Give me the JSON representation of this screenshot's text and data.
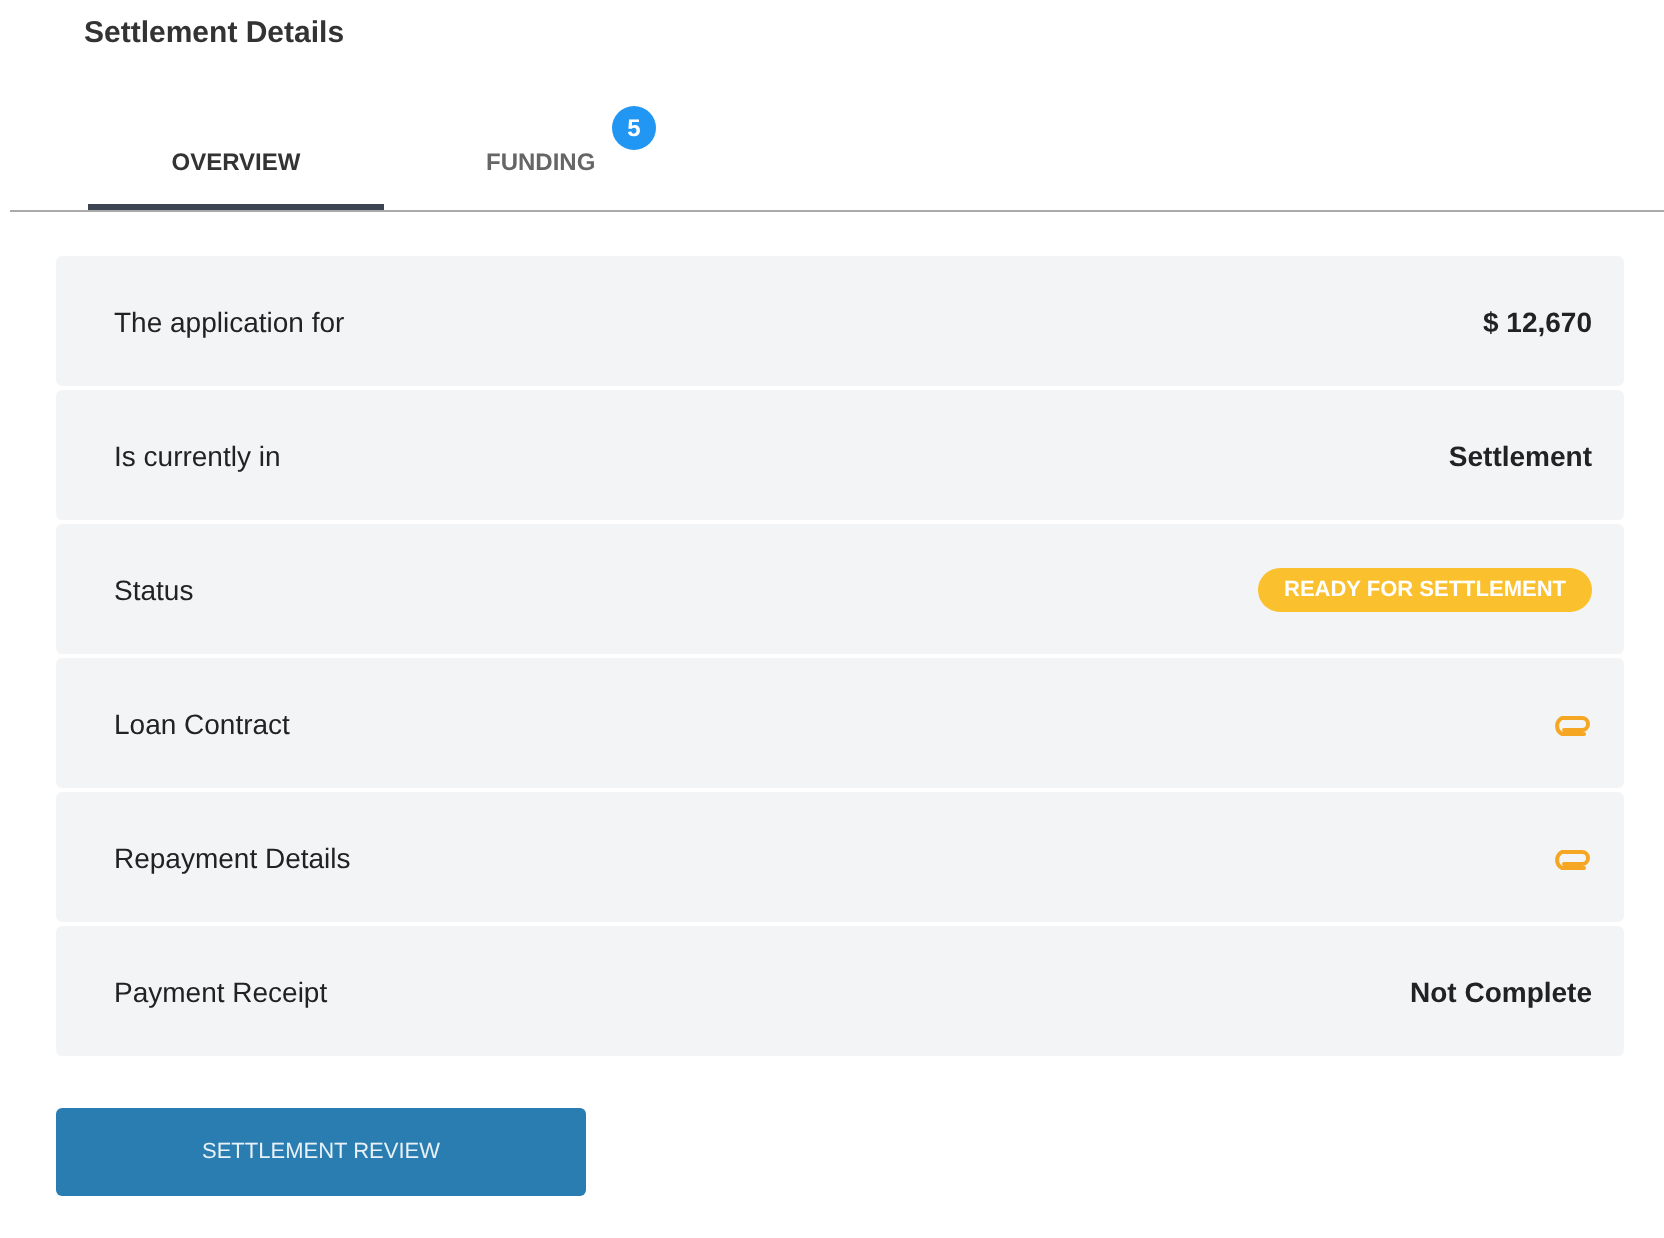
{
  "title": "Settlement Details",
  "tabs": [
    {
      "label": "OVERVIEW",
      "selected": true
    },
    {
      "label": "FUNDING",
      "selected": false,
      "badge": "5"
    }
  ],
  "rows": [
    {
      "label": "The application for",
      "kind": "text",
      "value": "$ 12,670"
    },
    {
      "label": "Is currently in",
      "kind": "text",
      "value": "Settlement"
    },
    {
      "label": "Status",
      "kind": "badge",
      "value": "READY FOR SETTLEMENT"
    },
    {
      "label": "Loan Contract",
      "kind": "attachment"
    },
    {
      "label": "Repayment Details",
      "kind": "attachment"
    },
    {
      "label": "Payment Receipt",
      "kind": "text",
      "value": "Not Complete"
    }
  ],
  "button": "SETTLEMENT REVIEW"
}
